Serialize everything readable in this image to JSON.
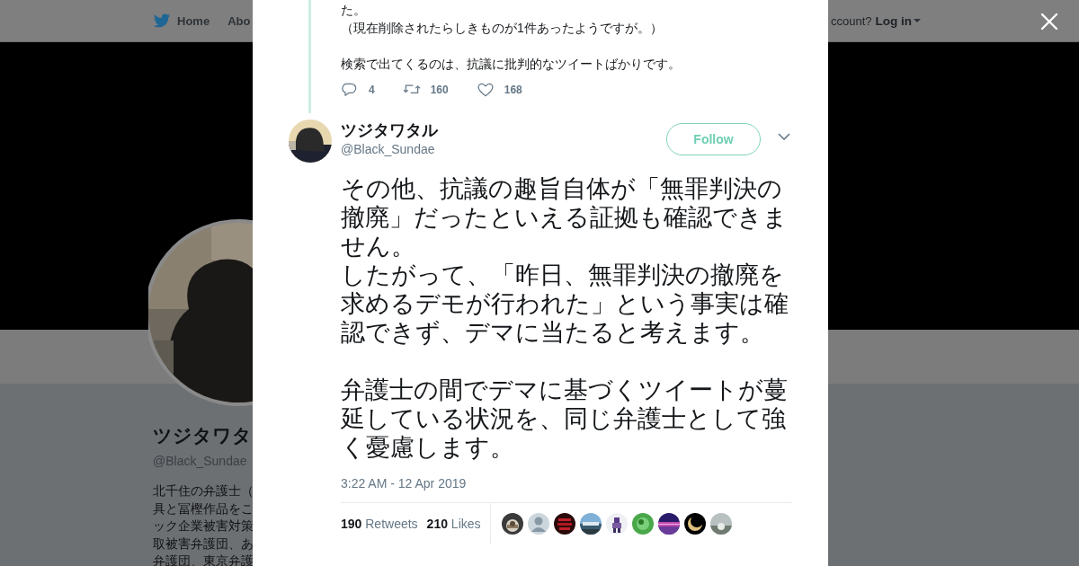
{
  "nav": {
    "items": [
      {
        "label": "Home",
        "kind": "home"
      },
      {
        "label": "Abo",
        "kind": "plain"
      }
    ],
    "login_prompt": "ccount?",
    "login": "Log in"
  },
  "profile": {
    "name": "ツジタワタ",
    "handle": "@Black_Sundae",
    "bio_lines": [
      "北千住の弁護士（",
      "具と冨樫作品をこ",
      "ック企業被害対策",
      "取被害弁護団、あ",
      "弁護団、東京弁護"
    ]
  },
  "previous_tweet": {
    "blocks": [
      [
        "た。",
        "（現在削除されたらしきものが1件あったようですが。）"
      ],
      [
        "検索で出てくるのは、抗議に批判的なツイートばかりです。"
      ]
    ],
    "actions": [
      {
        "kind": "reply",
        "count": "4"
      },
      {
        "kind": "retweet",
        "count": "160"
      },
      {
        "kind": "like",
        "count": "168"
      }
    ]
  },
  "tweet": {
    "name": "ツジタワタル",
    "handle": "@Black_Sundae",
    "follow": "Follow",
    "blocks": [
      [
        "その他、抗議の趣旨自体が「無罪判決の撤廃」だったといえる証拠も確認できません。",
        "したがって、「昨日、無罪判決の撤廃を求めるデモが行われた」という事実は確認できず、デマに当たると考えます。"
      ],
      [
        "弁護士の間でデマに基づくツイートが蔓延している状況を、同じ弁護士として強く憂慮します。"
      ]
    ],
    "timestamp": "3:22 AM - 12 Apr 2019",
    "retweets": "190",
    "retweets_label": "Retweets",
    "likes": "210",
    "likes_label": "Likes",
    "likers": [
      {
        "kind": "picture"
      },
      {
        "kind": "default-avatar"
      },
      {
        "kind": "picture"
      },
      {
        "kind": "picture"
      },
      {
        "kind": "picture"
      },
      {
        "kind": "picture"
      },
      {
        "kind": "picture"
      },
      {
        "kind": "picture"
      },
      {
        "kind": "picture"
      }
    ]
  }
}
